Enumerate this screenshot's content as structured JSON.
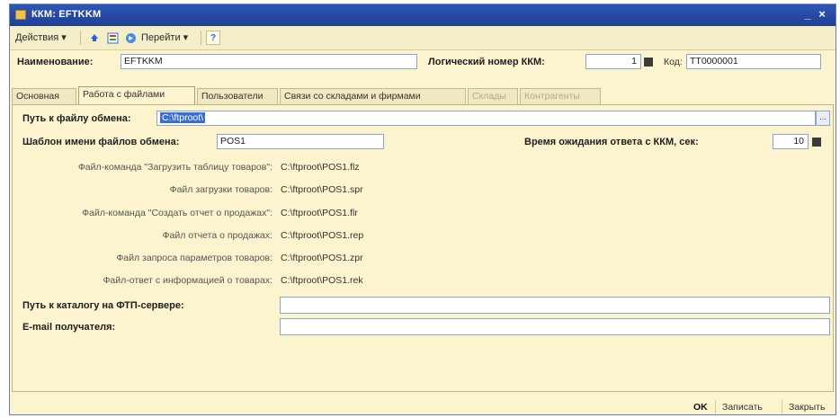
{
  "window": {
    "title": "ККМ: EFTKKM"
  },
  "toolbar": {
    "actions_label": "Действия",
    "goto_label": "Перейти",
    "help_label": "?"
  },
  "header": {
    "name_label": "Наименование:",
    "name_value": "EFTKKM",
    "logical_number_label": "Логический номер ККМ:",
    "logical_number_value": "1",
    "code_label": "Код:",
    "code_value": "ТТ0000001"
  },
  "tabs": [
    {
      "label": "Основная",
      "state": "normal"
    },
    {
      "label": "Работа с файлами",
      "state": "active"
    },
    {
      "label": "Пользователи",
      "state": "normal"
    },
    {
      "label": "Связи со складами и фирмами",
      "state": "normal"
    },
    {
      "label": "Склады",
      "state": "disabled"
    },
    {
      "label": "Контрагенты",
      "state": "disabled"
    }
  ],
  "files_tab": {
    "exchange_path_label": "Путь к файлу обмена:",
    "exchange_path_value": "C:\\ftproot\\",
    "template_label": "Шаблон имени файлов обмена:",
    "template_value": "POS1",
    "timeout_label": "Время ожидания ответа с ККМ, сек:",
    "timeout_value": "10",
    "file_rows": [
      {
        "label": "Файл-команда \"Загрузить таблицу товаров\":",
        "value": "C:\\ftproot\\POS1.flz"
      },
      {
        "label": "Файл загрузки товаров:",
        "value": "C:\\ftproot\\POS1.spr"
      },
      {
        "label": "Файл-команда \"Создать отчет о продажах\":",
        "value": "C:\\ftproot\\POS1.flr"
      },
      {
        "label": "Файл отчета о продажах:",
        "value": "C:\\ftproot\\POS1.rep"
      },
      {
        "label": "Файл запроса параметров товаров:",
        "value": "C:\\ftproot\\POS1.zpr"
      },
      {
        "label": "Файл-ответ с информацией о товарах:",
        "value": "C:\\ftproot\\POS1.rek"
      }
    ],
    "ftp_path_label": "Путь к каталогу на ФТП-сервере:",
    "ftp_path_value": "",
    "email_label": "E-mail получателя:",
    "email_value": ""
  },
  "footer": {
    "ok_label": "OK",
    "save_label": "Записать",
    "close_label": "Закрыть"
  },
  "colors": {
    "title_bar": "#2e57b6",
    "form_background": "#fbf4cf",
    "selection": "#3a6fd0"
  }
}
